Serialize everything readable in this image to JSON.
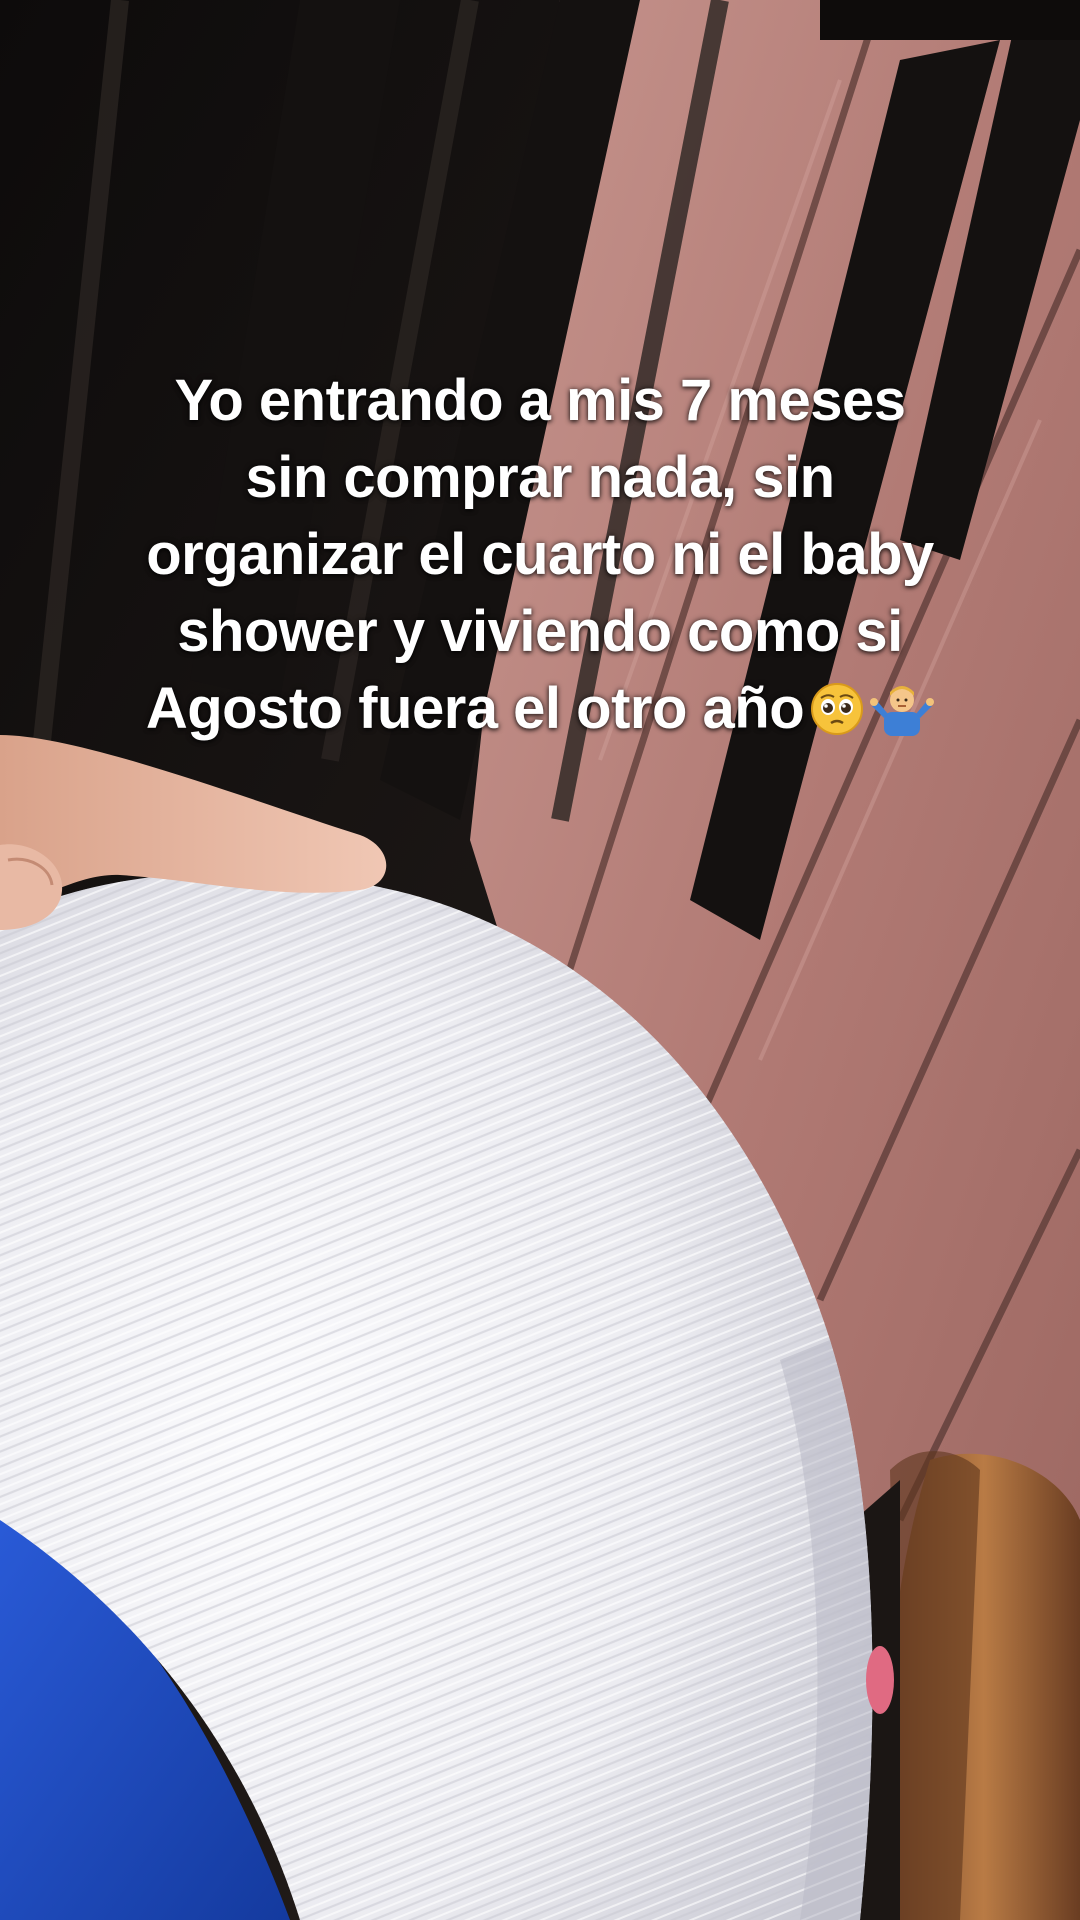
{
  "caption": {
    "lines": [
      "Yo entrando a mis 7 meses",
      "sin comprar nada, sin",
      "organizar el cuarto ni el baby",
      "shower y viviendo como si",
      "Agosto fuera el otro año"
    ],
    "emojis": [
      "pleading-face-emoji",
      "person-shrugging-emoji"
    ]
  },
  "colors": {
    "shirt": "#f1f1f5",
    "sleeve": "#1c49c4",
    "deck_boards": "#b98680",
    "railing": "#141110",
    "caption_text": "#ffffff"
  }
}
